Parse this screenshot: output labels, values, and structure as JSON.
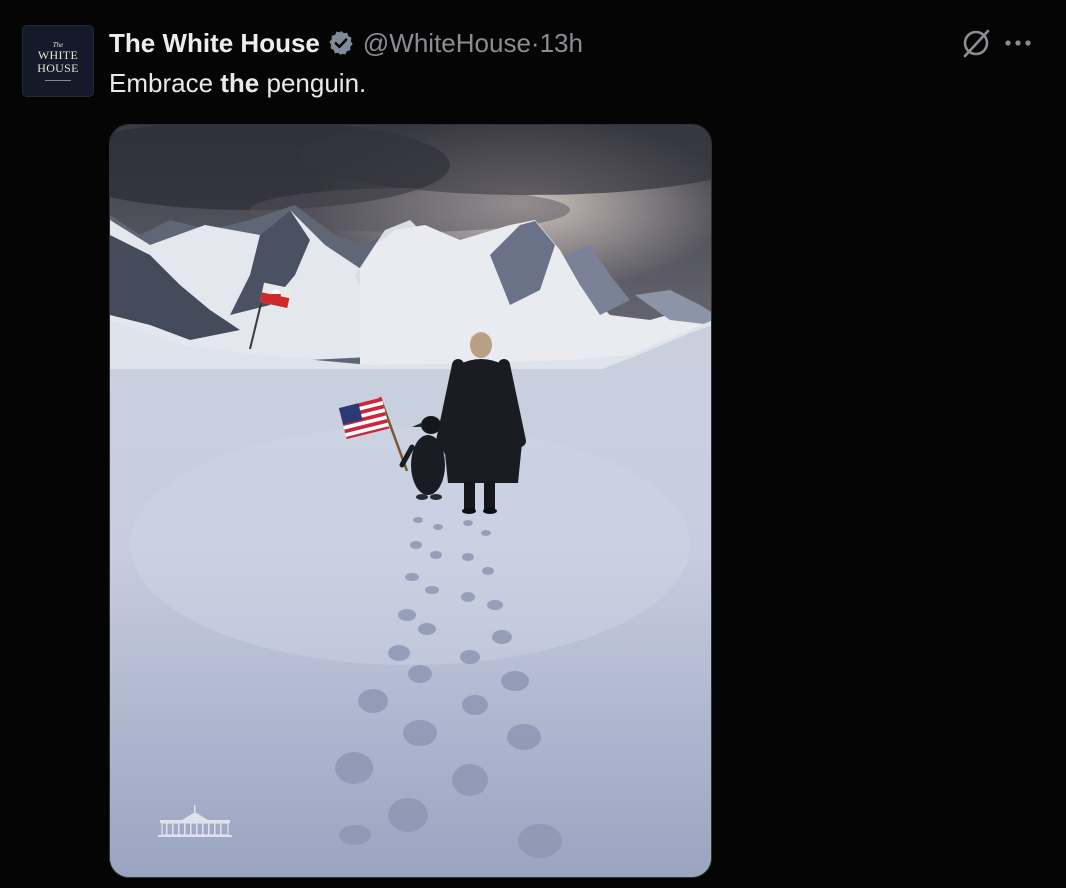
{
  "tweet": {
    "author": {
      "display_name": "The White House",
      "handle": "@WhiteHouse",
      "avatar_lines": [
        "The",
        "WHITE",
        "HOUSE"
      ],
      "verified_icon": "verified-badge-icon"
    },
    "separator": " · ",
    "timestamp": "13h",
    "text_parts": [
      "Embrace ",
      "the",
      " penguin."
    ],
    "actions": {
      "grok_icon": "grok-icon",
      "more_icon": "more-icon"
    },
    "media": {
      "alt": ""
    }
  },
  "colors": {
    "background": "#050505",
    "text_primary": "#e7e9ea",
    "text_secondary": "#8a8d91",
    "verified_badge": "#7e8a98"
  }
}
